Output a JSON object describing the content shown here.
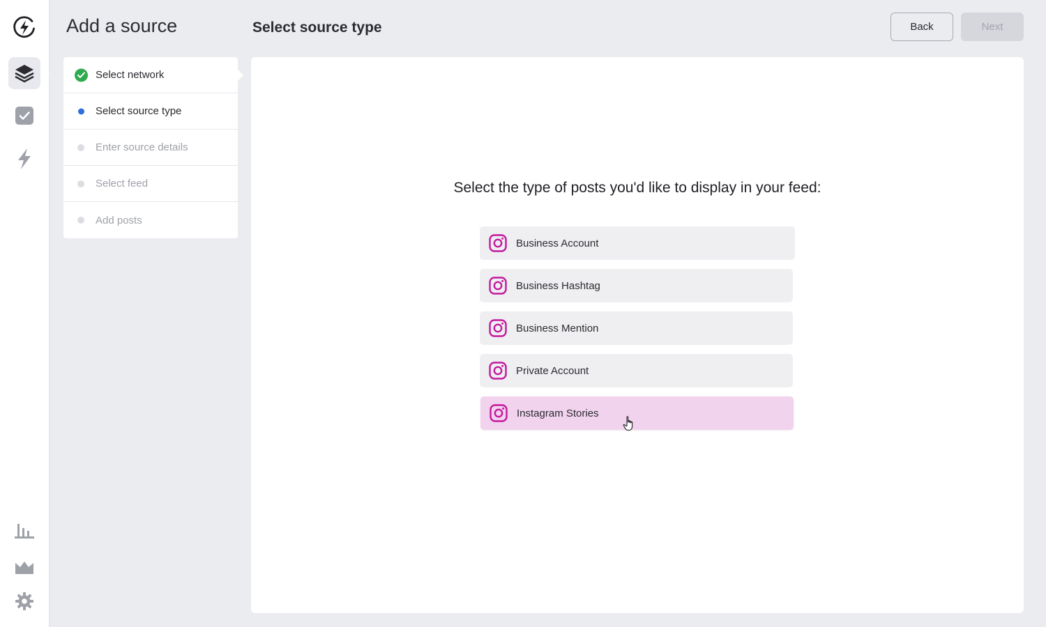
{
  "header": {
    "page_title": "Add a source",
    "step_title": "Select source type",
    "back_label": "Back",
    "next_label": "Next"
  },
  "rail": {
    "icons": [
      "logo-icon",
      "layers-icon",
      "checkbox-icon",
      "lightning-icon",
      "bar-chart-icon",
      "crown-icon",
      "gear-icon"
    ],
    "active": "layers-icon"
  },
  "steps": [
    {
      "label": "Select network",
      "state": "done"
    },
    {
      "label": "Select source type",
      "state": "current"
    },
    {
      "label": "Enter source details",
      "state": "pending"
    },
    {
      "label": "Select feed",
      "state": "pending"
    },
    {
      "label": "Add posts",
      "state": "pending"
    }
  ],
  "main": {
    "prompt": "Select the type of posts you'd like to display in your feed:",
    "options": [
      {
        "label": "Business Account",
        "icon": "instagram-icon"
      },
      {
        "label": "Business Hashtag",
        "icon": "instagram-icon"
      },
      {
        "label": "Business Mention",
        "icon": "instagram-icon"
      },
      {
        "label": "Private Account",
        "icon": "instagram-icon"
      },
      {
        "label": "Instagram Stories",
        "icon": "instagram-icon",
        "hovered": true
      }
    ]
  },
  "colors": {
    "accent_instagram": "#c3199e",
    "hover_bg": "#f2d3ee",
    "done_green": "#2faa4e",
    "current_blue": "#2f6fdc",
    "background": "#ebecf0"
  }
}
